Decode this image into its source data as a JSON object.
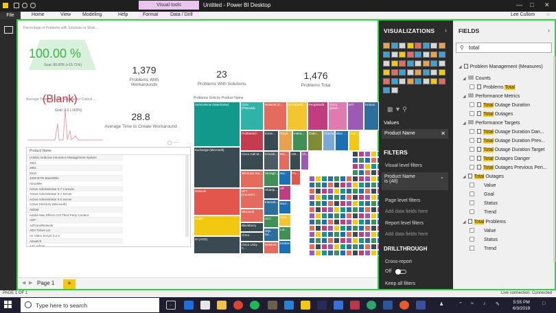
{
  "window": {
    "title": "Untitled - Power BI Desktop",
    "context_tab": "Visual tools",
    "user": "Lee Cullom"
  },
  "ribbon": {
    "tabs": [
      "File",
      "Home",
      "View",
      "Modeling",
      "Help",
      "Format",
      "Data / Drill"
    ]
  },
  "report": {
    "gauge_title": "Percentage of Problems with Solutions or Work...",
    "gauge_value": "100.00 %",
    "gauge_goal": "Goal: 80.00% (+15.71%)",
    "kpis": [
      {
        "value": "1,379",
        "label": "Problems With Workarounds"
      },
      {
        "value": "23",
        "label": "Problems With Solutions"
      },
      {
        "value": "1,476",
        "label": "Problems Total"
      }
    ],
    "avg_solution_title": "Average Time to Create Solution for Critical ...",
    "blank_value": "(Blank)",
    "blank_goal": "Goal: 0.0 (-100%)",
    "workaround_value": "28.8",
    "workaround_label": "Average Time to Create Workaround",
    "treemap_title": "Problems Sold by Product Name",
    "table_header": "Product Name",
    "table_rows": [
      "(AIMS) Ambrose Insurance Management System",
      "2821",
      "2851",
      "2910",
      "3330 BTW Base/Wiki",
      "AboutMe",
      "Active Administrator 8.7 Console",
      "Active Administrator 8.7 Server",
      "Active Administrator 9.0 Server",
      "Active Directory (Microsoft)",
      "ADDM",
      "Adobe Mac Effects Ctrl Third Party Content",
      "ADP",
      "AdTranslNetwork",
      "ADV Ticket Lot",
      "Air Video Server 2.2.3",
      "Airwatch",
      "AJC Admin",
      "AJC New Wiki"
    ],
    "treemap_tiles": [
      {
        "label": "ServiceNow (Mainframe)",
        "color": "#119a8c"
      },
      {
        "label": "Exchange (Microsoft)",
        "color": "#3a4a52"
      },
      {
        "label": "Network",
        "color": "#e2564c"
      },
      {
        "label": "Hudle",
        "color": "#f2c811"
      },
      {
        "label": "IS (ACD)",
        "color": "#3a4a52"
      },
      {
        "label": "Citrix (Planned)",
        "color": "#2fb3a7"
      },
      {
        "label": "Network (C...",
        "color": "#e66b5f"
      },
      {
        "label": "Not Specif...",
        "color": "#f3c630"
      },
      {
        "label": "PeopleSoft",
        "color": "#c03e7f"
      },
      {
        "label": "Cisco (pend...",
        "color": "#e07bb0"
      },
      {
        "label": "DTI",
        "color": "#9c5ab5"
      },
      {
        "label": "Kronos",
        "color": "#2e6e9c"
      },
      {
        "label": "ProfitMatch",
        "color": "#c43c4e"
      },
      {
        "label": "Exten...",
        "color": "#3a4a52"
      },
      {
        "label": "Great",
        "color": "#e8a24e"
      },
      {
        "label": "Intera...",
        "color": "#3f8f57"
      },
      {
        "label": "Outlo...",
        "color": "#7f8c34"
      },
      {
        "label": "Cbenut",
        "color": "#7aa9d8"
      },
      {
        "label": "Blue ...",
        "color": "#1a6fb5"
      },
      {
        "label": "Cisc...",
        "color": "#f2c811"
      },
      {
        "label": "Cisco Call M...",
        "color": "#3a4a52"
      },
      {
        "label": "Crossb...",
        "color": "#4b5a63"
      },
      {
        "label": "Mic...",
        "color": "#e66b5f"
      },
      {
        "label": "Vist...",
        "color": "#3a4a52"
      },
      {
        "label": "Ch...",
        "color": "#9c5ab5"
      },
      {
        "label": "Windows Ser...",
        "color": "#e66b5f"
      },
      {
        "label": "Storage...",
        "color": "#3f8f57"
      },
      {
        "label": "Sharep...",
        "color": "#3a4a52"
      },
      {
        "label": "Nw...",
        "color": "#1a6fb5"
      },
      {
        "label": "Pe...",
        "color": "#e2564c"
      },
      {
        "label": "SFT (Counter)...",
        "color": "#e66b5f"
      },
      {
        "label": "Internal...",
        "color": "#2e6e9c"
      },
      {
        "label": "AP",
        "color": "#c03e7f"
      },
      {
        "label": "Microsoft",
        "color": "#e66b5f"
      },
      {
        "label": "Blackberry",
        "color": "#3a4a52"
      },
      {
        "label": "SCC",
        "color": "#3f8f57"
      },
      {
        "label": "Mod...",
        "color": "#1a6fb5"
      },
      {
        "label": "SQL Se...",
        "color": "#2e6e9c"
      },
      {
        "label": "Ama...",
        "color": "#f3c630"
      },
      {
        "label": "Cisco",
        "color": "#3a4a52"
      },
      {
        "label": "Network...",
        "color": "#e66b5f"
      },
      {
        "label": "Cisco Unity C...",
        "color": "#3a4a52"
      },
      {
        "label": "Lot...",
        "color": "#3f8f57"
      },
      {
        "label": "Kerberos",
        "color": "#1a6fb5"
      }
    ],
    "page_tab": "Page 1",
    "add_page": "+"
  },
  "visualizations": {
    "header": "VISUALIZATIONS",
    "values_label": "Values",
    "value_field": "Product Name",
    "filters_header": "FILTERS",
    "visual_level": "Visual level filters",
    "filter_field": "Product Name",
    "filter_state": "is (All)",
    "page_level": "Page level filters",
    "add_data_page": "Add data fields here",
    "report_level": "Report level filters",
    "add_data_report": "Add data fields here",
    "drillthrough_header": "DRILLTHROUGH",
    "cross_report": "Cross-report",
    "toggle_state": "Off",
    "keep_filters": "Keep all filters"
  },
  "fields": {
    "header": "FIELDS",
    "search_value": "total",
    "table_name": "Problem Management (Measures)",
    "counts_folder": "Counts",
    "problems_total_prefix": "Problems ",
    "highlight": "Total",
    "perf_metrics_folder": "Performance Metrics",
    "perf_metrics": [
      " Outage Duration",
      " Outages"
    ],
    "perf_targets_folder": "Performance Targets",
    "perf_targets": [
      " Outage Duration Dan...",
      " Outage Duration Prev...",
      " Outage Duration Target",
      " Outages Danger",
      " Outages Previous Peri..."
    ],
    "outages_kpi_suffix": " Outages",
    "problems_kpi_suffix": " Problems",
    "kpi_children": [
      "Value",
      "Goal",
      "Status",
      "Trend"
    ],
    "kpi2_children": [
      "Value",
      "Status",
      "Trend"
    ]
  },
  "status": {
    "page": "PAGE 1 OF 1",
    "connection": "Live connection: Connected"
  },
  "taskbar": {
    "search_placeholder": "Type here to search",
    "time": "5:55 PM",
    "date": "6/3/2019"
  }
}
